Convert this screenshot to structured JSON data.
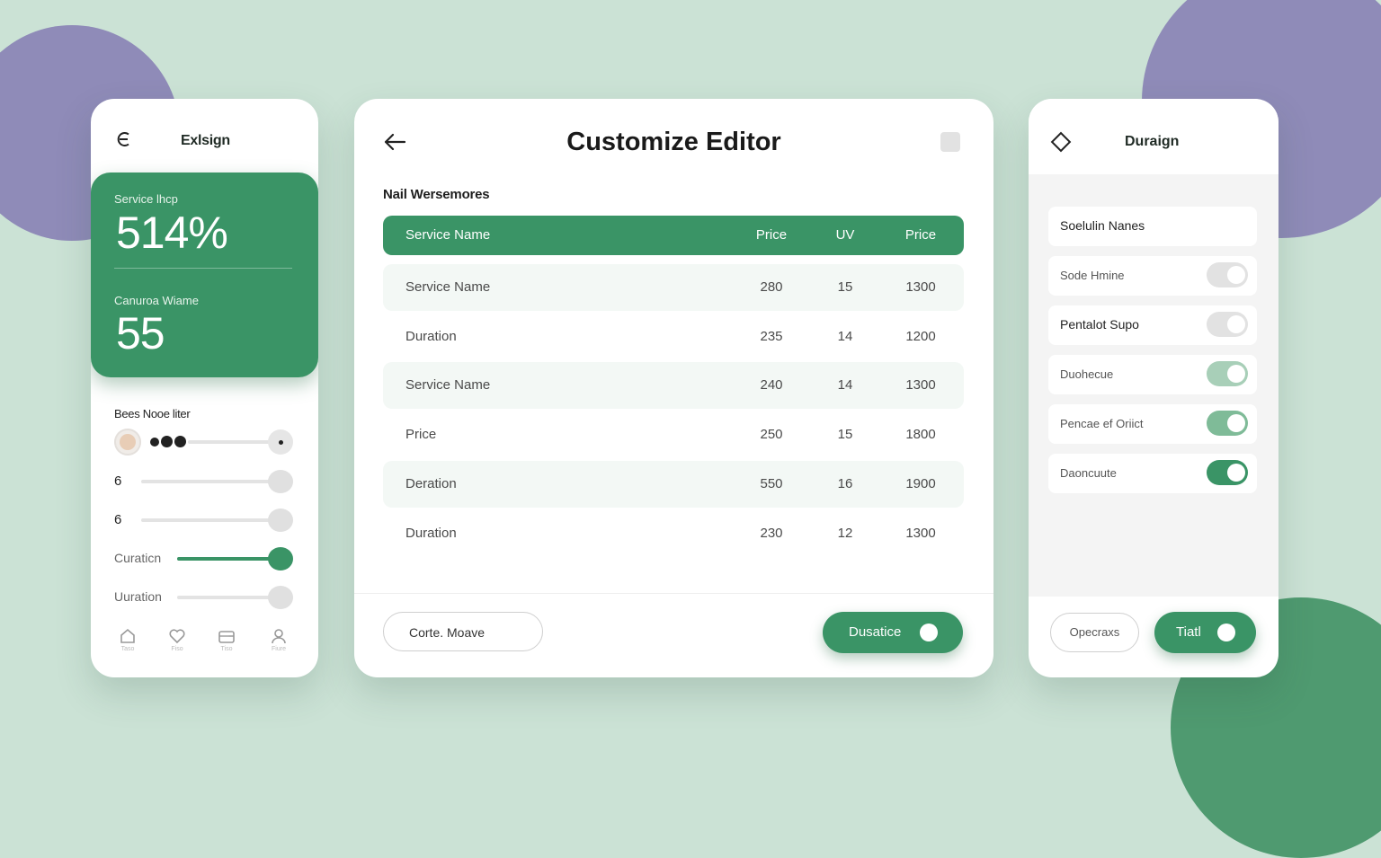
{
  "colors": {
    "accent": "#3a9466",
    "background": "#cbe2d5",
    "blob_purple": "#8f8bb8"
  },
  "left": {
    "title": "Exlsign",
    "stat1": {
      "label": "Service lhcp",
      "value": "514%"
    },
    "stat2": {
      "label": "Canuroa Wiame",
      "value": "55"
    },
    "section_label": "Bees Nooe liter",
    "sliders": [
      {
        "label": "",
        "level": 0.0
      },
      {
        "label": "6",
        "level": 0.0
      },
      {
        "label": "6",
        "level": 0.0
      },
      {
        "label": "Curaticn",
        "level": 1.0
      },
      {
        "label": "Uuration",
        "level": 0.0
      }
    ],
    "tabs": [
      {
        "icon": "home-icon",
        "label": "Taso"
      },
      {
        "icon": "heart-icon",
        "label": "Fiso"
      },
      {
        "icon": "briefcase-icon",
        "label": "Tiso"
      },
      {
        "icon": "user-icon",
        "label": "Fiure"
      }
    ]
  },
  "center": {
    "title": "Customize Editor",
    "subtitle": "Nail Wersemores",
    "columns": [
      "Service Name",
      "Price",
      "UV",
      "Price"
    ],
    "rows": [
      [
        "Service Name",
        "280",
        "15",
        "1300"
      ],
      [
        "Duration",
        "235",
        "14",
        "1200"
      ],
      [
        "Service Name",
        "240",
        "14",
        "1300"
      ],
      [
        "Price",
        "250",
        "15",
        "1800"
      ],
      [
        "Deration",
        "550",
        "16",
        "1900"
      ],
      [
        "Duration",
        "230",
        "12",
        "1300"
      ]
    ],
    "secondary_button": "Corte. Moave",
    "primary_button": "Dusatice"
  },
  "right": {
    "title": "Duraign",
    "items": [
      {
        "label": "Soelulin Nanes",
        "toggle": null
      },
      {
        "label": "Sode Hmine",
        "toggle": "off"
      },
      {
        "label": "Pentalot Supo",
        "toggle": "off"
      },
      {
        "label": "Duohecue",
        "toggle": "on"
      },
      {
        "label": "Pencae ef Oriict",
        "toggle": "on"
      },
      {
        "label": "Daoncuute",
        "toggle": "on"
      }
    ],
    "secondary_button": "Opecraxs",
    "primary_button": "Tiatl"
  }
}
